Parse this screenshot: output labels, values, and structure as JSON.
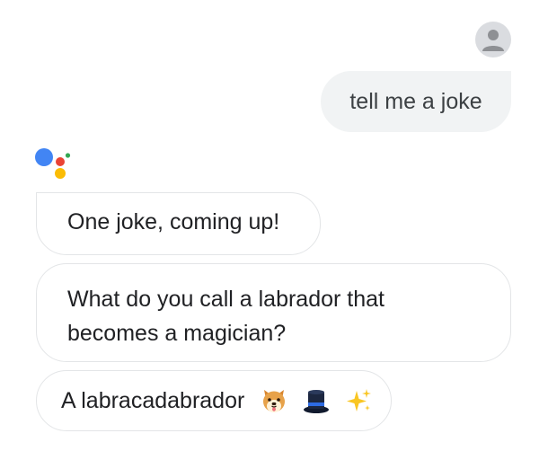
{
  "conversation": {
    "user_message": "tell me a joke",
    "assistant_messages": [
      {
        "lines": [
          "One joke, coming up!"
        ]
      },
      {
        "lines": [
          "What do you call a labrador that",
          "becomes a magician?"
        ]
      },
      {
        "lines": [
          "A labracadabrador"
        ],
        "emojis": [
          "dog-face-icon",
          "top-hat-icon",
          "sparkles-icon"
        ]
      }
    ]
  },
  "icons": {
    "user_avatar": "person-avatar-icon",
    "assistant_logo": "google-assistant-logo-icon"
  },
  "colors": {
    "user_bubble_bg": "#f1f3f4",
    "assistant_border": "#e3e5e7",
    "avatar_bg": "#dadce0",
    "logo_blue": "#4285f4",
    "logo_red": "#ea4335",
    "logo_yellow": "#fbbc04",
    "logo_green": "#34a853"
  }
}
